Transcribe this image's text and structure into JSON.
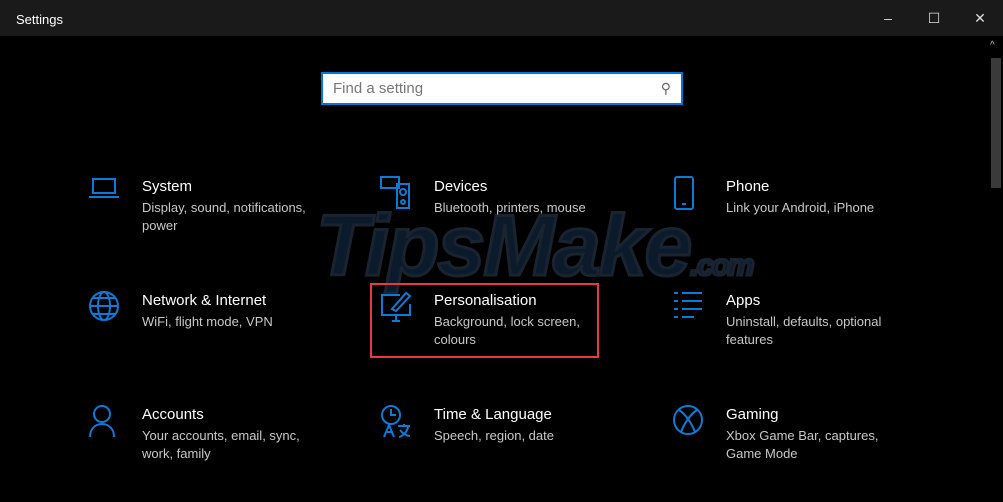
{
  "window": {
    "title": "Settings",
    "minimize": "–",
    "maximize": "☐",
    "close": "✕"
  },
  "search": {
    "placeholder": "Find a setting"
  },
  "watermark": {
    "text": "TipsMake",
    ".com": ".com"
  },
  "items": [
    {
      "title": "System",
      "desc": "Display, sound, notifications, power",
      "icon": "laptop-icon"
    },
    {
      "title": "Devices",
      "desc": "Bluetooth, printers, mouse",
      "icon": "devices-icon"
    },
    {
      "title": "Phone",
      "desc": "Link your Android, iPhone",
      "icon": "phone-icon"
    },
    {
      "title": "Network & Internet",
      "desc": "WiFi, flight mode, VPN",
      "icon": "globe-icon"
    },
    {
      "title": "Personalisation",
      "desc": "Background, lock screen, colours",
      "icon": "paint-icon"
    },
    {
      "title": "Apps",
      "desc": "Uninstall, defaults, optional features",
      "icon": "apps-list-icon"
    },
    {
      "title": "Accounts",
      "desc": "Your accounts, email, sync, work, family",
      "icon": "person-icon"
    },
    {
      "title": "Time & Language",
      "desc": "Speech, region, date",
      "icon": "time-language-icon"
    },
    {
      "title": "Gaming",
      "desc": "Xbox Game Bar, captures, Game Mode",
      "icon": "xbox-icon"
    }
  ],
  "colors": {
    "accent": "#0078d7",
    "highlight": "#e8393f"
  }
}
